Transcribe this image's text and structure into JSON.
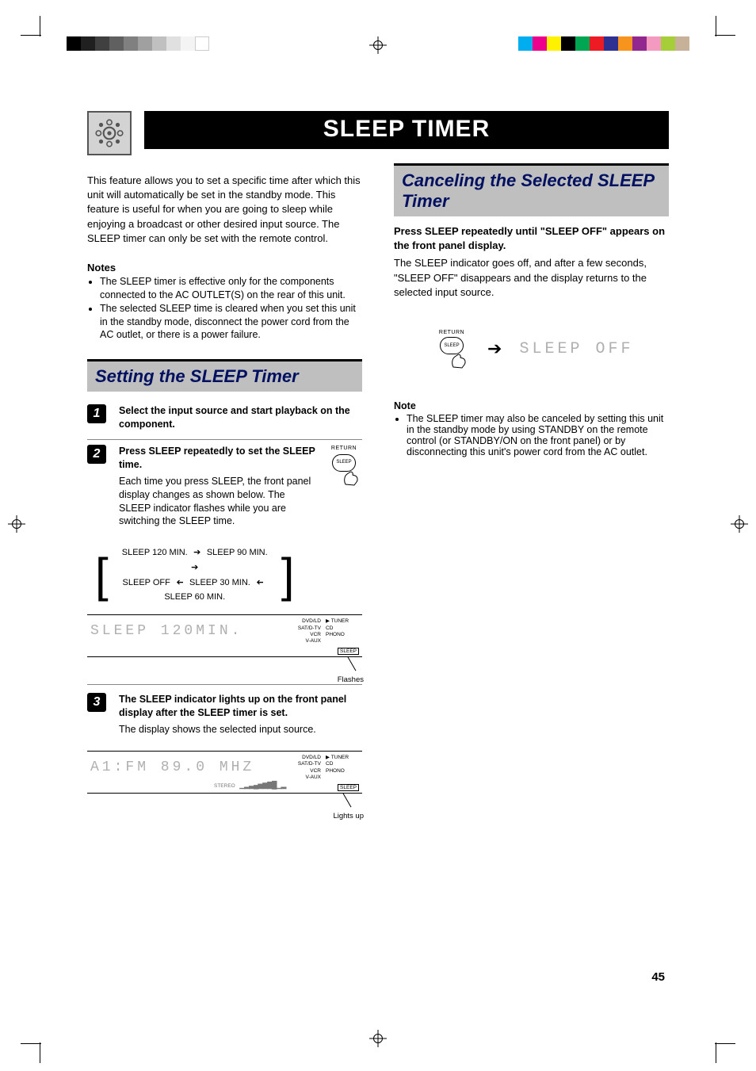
{
  "title": "SLEEP TIMER",
  "page_number": "45",
  "intro": "This feature allows you to set a specific time after which this unit will automatically be set in the standby mode. This feature is useful for when you are going to sleep while enjoying a broadcast or other desired input source. The SLEEP timer can only be set with the remote control.",
  "notes_heading": "Notes",
  "notes": [
    "The SLEEP timer is effective only for the components connected to the AC OUTLET(S) on the rear of this unit.",
    "The selected SLEEP time is cleared when you set this unit in the standby mode, disconnect the power cord from the AC outlet, or there is a power failure."
  ],
  "section1_heading": "Setting the SLEEP Timer",
  "steps": [
    {
      "num": "1",
      "main": "Select the input source and start playback on the component.",
      "sub": ""
    },
    {
      "num": "2",
      "main": "Press SLEEP repeatedly to set the SLEEP time.",
      "sub": "Each time you press SLEEP, the front panel display changes as shown below. The SLEEP indicator flashes while you are switching the SLEEP time."
    },
    {
      "num": "3",
      "main": "The SLEEP indicator lights up on the front panel display after the SLEEP timer is set.",
      "sub": "The display shows the selected input source."
    }
  ],
  "flow": {
    "items": [
      "SLEEP 120 MIN.",
      "SLEEP 90 MIN.",
      "SLEEP 60 MIN.",
      "SLEEP 30 MIN.",
      "SLEEP OFF"
    ]
  },
  "lcd1": {
    "seg": "SLEEP 120MIN.",
    "legend1": [
      "DVD/LD",
      "SAT/D-TV",
      "VCR",
      "V-AUX"
    ],
    "legend2": [
      "TUNER",
      "CD",
      "PHONO"
    ],
    "sleep_ind": "SLEEP",
    "caption": "Flashes"
  },
  "lcd2": {
    "seg": "A1:FM 89.0 MHZ",
    "stereo": "STEREO",
    "legend1": [
      "DVD/LD",
      "SAT/D-TV",
      "VCR",
      "V-AUX"
    ],
    "legend2": [
      "TUNER",
      "CD",
      "PHONO"
    ],
    "sleep_ind": "SLEEP",
    "caption": "Lights up"
  },
  "remote_button": {
    "caption": "RETURN",
    "label": "SLEEP"
  },
  "right": {
    "heading": "Canceling the Selected SLEEP Timer",
    "intro": "Press SLEEP repeatedly until \"SLEEP OFF\" appears on the front panel display.",
    "sub": "The SLEEP indicator goes off, and after a few seconds, \"SLEEP OFF\" disappears and the display returns to the selected input source.",
    "lcdseg": "SLEEP OFF",
    "note_heading": "Note",
    "note_items": [
      "The SLEEP timer may also be canceled by setting this unit in the standby mode by using STANDBY on the remote control (or STANDBY/ON on the front panel) or by disconnecting this unit's power cord from the AC outlet."
    ]
  },
  "colors": {
    "grayscale": [
      "#000000",
      "#202020",
      "#404040",
      "#606060",
      "#808080",
      "#a0a0a0",
      "#c0c0c0",
      "#e0e0e0",
      "#f4f4f4",
      "#ffffff"
    ],
    "process": [
      "#00aeef",
      "#ec008c",
      "#fff200",
      "#000000",
      "#00a651",
      "#ed1c24",
      "#2e3192",
      "#f7941d",
      "#92278f",
      "#f49ac1",
      "#a6ce39",
      "#c7b299"
    ]
  }
}
